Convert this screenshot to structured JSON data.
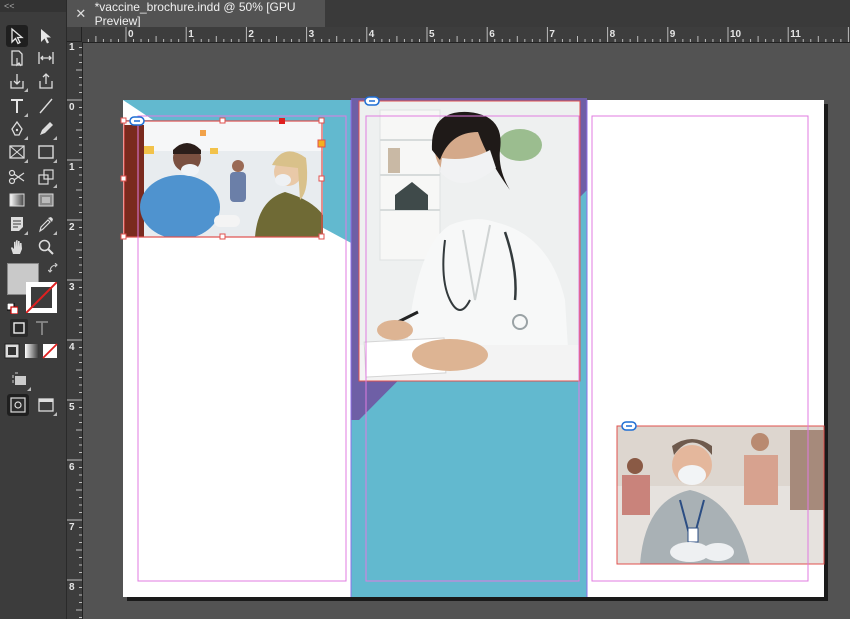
{
  "window": {
    "collapse_label": "<<"
  },
  "tab": {
    "title": "*vaccine_brochure.indd @ 50% [GPU Preview]",
    "close_glyph": "✕"
  },
  "rulers": {
    "horizontal_labels": [
      "0",
      "1",
      "2",
      "3",
      "4",
      "5",
      "6",
      "7",
      "8",
      "9",
      "10",
      "11"
    ],
    "vertical_labels": [
      "1",
      "0",
      "1",
      "2",
      "3",
      "4",
      "5",
      "6",
      "7",
      "8"
    ]
  },
  "tools": [
    {
      "name": "selection-tool-icon"
    },
    {
      "name": "direct-selection-tool-icon"
    },
    {
      "name": "page-tool-icon"
    },
    {
      "name": "gap-tool-icon"
    },
    {
      "name": "content-collector-icon"
    },
    {
      "name": "content-placer-icon"
    },
    {
      "name": "type-tool-icon"
    },
    {
      "name": "line-tool-icon"
    },
    {
      "name": "pen-tool-icon"
    },
    {
      "name": "pencil-tool-icon"
    },
    {
      "name": "rectangle-frame-tool-icon"
    },
    {
      "name": "rectangle-tool-icon"
    },
    {
      "name": "scissors-tool-icon"
    },
    {
      "name": "free-transform-tool-icon"
    },
    {
      "name": "gradient-swatch-tool-icon"
    },
    {
      "name": "gradient-feather-tool-icon"
    },
    {
      "name": "note-tool-icon"
    },
    {
      "name": "eyedropper-tool-icon"
    },
    {
      "name": "hand-tool-icon"
    },
    {
      "name": "zoom-tool-icon"
    }
  ],
  "colors": {
    "teal": "#62b9cf",
    "purple": "#6e5fa6",
    "paper": "#ffffff",
    "pasteboard": "#535353",
    "margin_guide": "#e07be0",
    "frame_red": "#e0504e"
  },
  "images": [
    {
      "name": "nurse-vaccinating-patient-photo"
    },
    {
      "name": "doctor-writing-photo"
    },
    {
      "name": "doctor-waiting-room-photo"
    }
  ]
}
